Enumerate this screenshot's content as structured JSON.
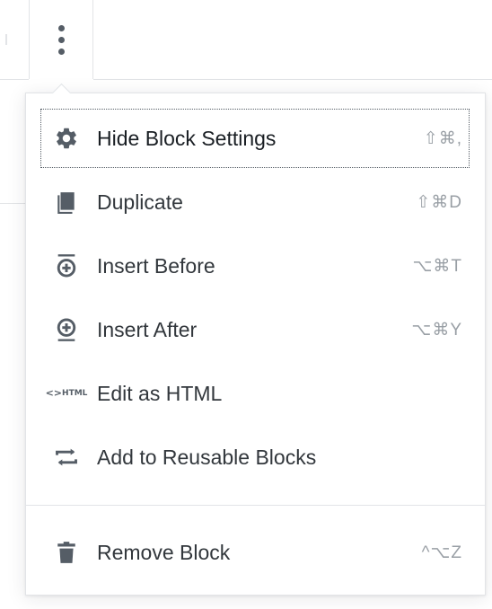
{
  "toolbar": {
    "more_icon": "ellipsis-vertical-icon"
  },
  "menu": {
    "items": [
      {
        "label": "Hide Block Settings",
        "shortcut": "⇧⌘,",
        "icon": "gear-icon"
      },
      {
        "label": "Duplicate",
        "shortcut": "⇧⌘D",
        "icon": "duplicate-icon"
      },
      {
        "label": "Insert Before",
        "shortcut": "⌥⌘T",
        "icon": "insert-before-icon"
      },
      {
        "label": "Insert After",
        "shortcut": "⌥⌘Y",
        "icon": "insert-after-icon"
      },
      {
        "label": "Edit as HTML",
        "shortcut": "",
        "icon": "html-icon",
        "icon_text_top": "<>",
        "icon_text_bottom": "HTML"
      },
      {
        "label": "Add to Reusable Blocks",
        "shortcut": "",
        "icon": "reusable-blocks-icon"
      },
      {
        "label": "Remove Block",
        "shortcut": "^⌥Z",
        "icon": "trash-icon"
      }
    ]
  },
  "colors": {
    "icon": "#555d66",
    "text": "#32373c",
    "shortcut": "#999fa5",
    "border": "#e2e4e7"
  }
}
